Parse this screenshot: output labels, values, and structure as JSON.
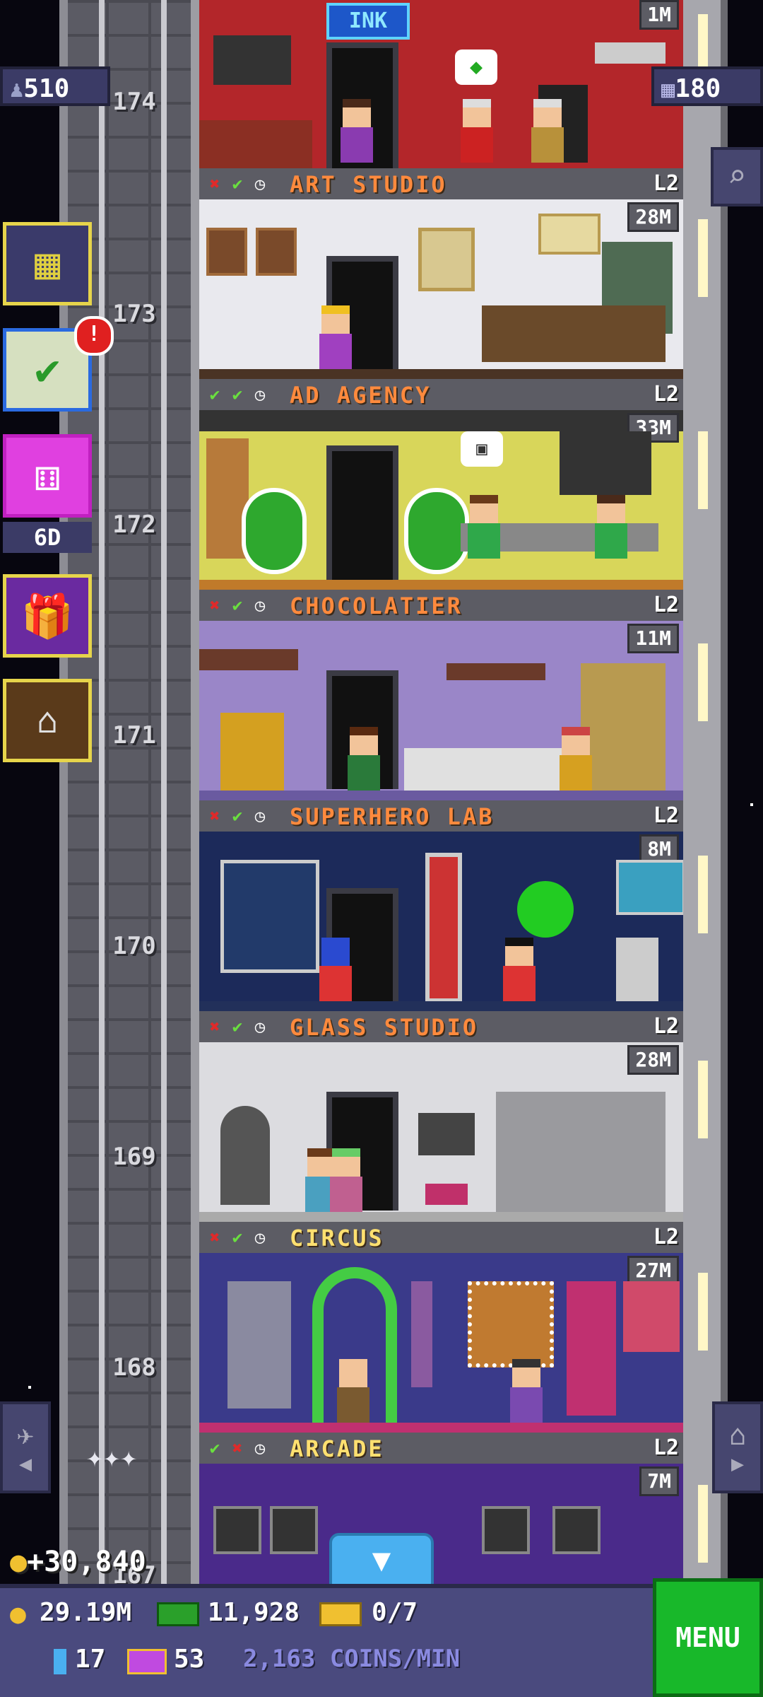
{
  "top_counters": {
    "population": "510",
    "bux_floors": "180"
  },
  "side_menu": {
    "dice_timer": "6D"
  },
  "floors": [
    {
      "name": "",
      "level": "",
      "stock": "1M",
      "floor_number": "174"
    },
    {
      "name": "ART STUDIO",
      "level": "L2",
      "stock": "28M",
      "floor_number": "173",
      "status": [
        "x",
        "check",
        "clock"
      ]
    },
    {
      "name": "AD AGENCY",
      "level": "L2",
      "stock": "33M",
      "floor_number": "172",
      "status": [
        "check",
        "check",
        "clock"
      ]
    },
    {
      "name": "CHOCOLATIER",
      "level": "L2",
      "stock": "11M",
      "floor_number": "171",
      "status": [
        "x",
        "check",
        "clock"
      ]
    },
    {
      "name": "SUPERHERO LAB",
      "level": "L2",
      "stock": "8M",
      "floor_number": "170",
      "status": [
        "x",
        "check",
        "clock"
      ]
    },
    {
      "name": "GLASS STUDIO",
      "level": "L2",
      "stock": "28M",
      "floor_number": "169",
      "status": [
        "x",
        "check",
        "clock"
      ]
    },
    {
      "name": "CIRCUS",
      "level": "L2",
      "stock": "27M",
      "floor_number": "168",
      "status": [
        "x",
        "check",
        "clock"
      ]
    },
    {
      "name": "ARCADE",
      "level": "L2",
      "stock": "7M",
      "floor_number": "167",
      "status": [
        "check",
        "x",
        "clock"
      ]
    }
  ],
  "first_floor_sign": "INK",
  "income_popup": "+30,840",
  "bottom_bar": {
    "coins": "29.19M",
    "bux": "11,928",
    "tickets": "0/7",
    "keys": "17",
    "vip": "53",
    "rate": "2,163 COINS/MIN",
    "menu_label": "MENU"
  },
  "colors": {
    "floor_name": "#ff8a3d",
    "menu_green": "#18b82a",
    "bottom_bar": "#4a4a7e"
  }
}
